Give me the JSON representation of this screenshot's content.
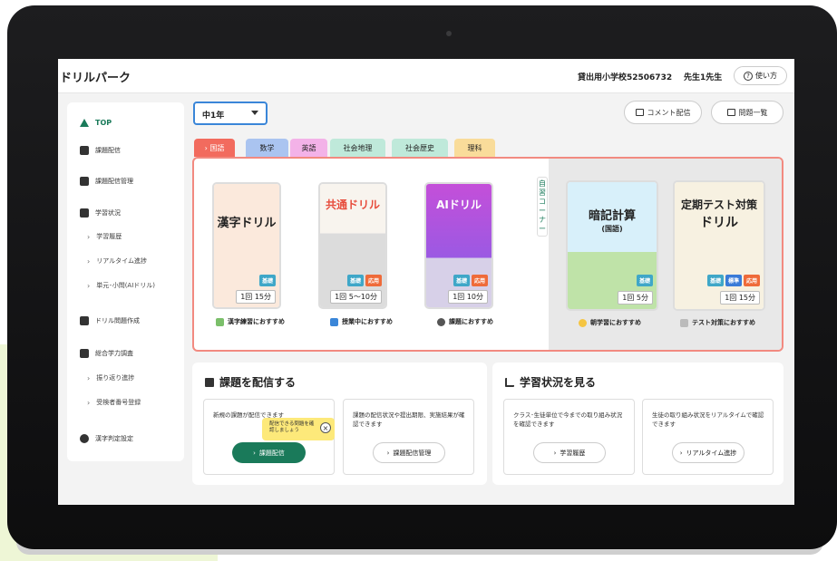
{
  "app": {
    "title": "ドリルパーク",
    "school": "貸出用小学校52506732",
    "teacher": "先生1先生",
    "help_label": "使い方",
    "help_icon": "?"
  },
  "sidebar": {
    "items": [
      {
        "label": "TOP",
        "icon": "home-icon"
      },
      {
        "label": "課題配信",
        "icon": "assignment-icon"
      },
      {
        "label": "課題配信管理",
        "icon": "assignment-manage-icon"
      },
      {
        "label": "学習状況",
        "icon": "chart-icon"
      },
      {
        "label": "学習履歴",
        "icon": "chevron-right-icon"
      },
      {
        "label": "リアルタイム進捗",
        "icon": "chevron-right-icon"
      },
      {
        "label": "単元･小問(AIドリル)",
        "icon": "chevron-right-icon"
      },
      {
        "label": "ドリル問題作成",
        "icon": "pencil-icon"
      },
      {
        "label": "総合学力調査",
        "icon": "people-icon"
      },
      {
        "label": "振り返り進捗",
        "icon": "chevron-right-icon"
      },
      {
        "label": "受検者番号登録",
        "icon": "chevron-right-icon"
      },
      {
        "label": "漢字判定設定",
        "icon": "check-circle-icon"
      }
    ],
    "chevron": "›"
  },
  "grade_select": {
    "value": "中1年"
  },
  "toolbar": {
    "comment_label": "コメント配信",
    "list_label": "問題一覧"
  },
  "tabs": [
    {
      "label": "› 国語",
      "color": "#f26b5e",
      "active": true
    },
    {
      "label": "数学",
      "color": "#aac4f0"
    },
    {
      "label": "英語",
      "color": "#f3b2e8"
    },
    {
      "label": "社会地理",
      "color": "#bfe9da"
    },
    {
      "label": "社会歴史",
      "color": "#bfe9da"
    },
    {
      "label": "理科",
      "color": "#f9dc9a"
    }
  ],
  "jishu_label": "自習コーナー",
  "drills": [
    {
      "title": "漢字ドリル",
      "badges": [
        "基礎"
      ],
      "time": "1回 15分",
      "rec": "漢字練習におすすめ"
    },
    {
      "title": "共通ドリル",
      "badges": [
        "基礎",
        "応用"
      ],
      "time": "1回 5〜10分",
      "rec": "授業中におすすめ"
    },
    {
      "title": "AIドリル",
      "badges": [
        "基礎",
        "応用"
      ],
      "time": "1回 10分",
      "rec": "課題におすすめ"
    },
    {
      "title": "暗記計算",
      "subtitle": "(国語)",
      "badges": [
        "基礎"
      ],
      "time": "1回 5分",
      "rec": "朝学習におすすめ"
    },
    {
      "title": "定期テスト対策",
      "title2": "ドリル",
      "badges": [
        "基礎",
        "標準",
        "応用"
      ],
      "time": "1回 15分",
      "rec": "テスト対策におすすめ"
    }
  ],
  "assign_section": {
    "title": "課題を配信する",
    "box1": {
      "text": "新規の課題が配信できます",
      "button": "課題配信",
      "tooltip": "配信できる問題を確認しましょう",
      "tooltip_close": "×"
    },
    "box2": {
      "text": "課題の配信状況や提出期限、実施結果が確認できます",
      "button": "課題配信管理"
    }
  },
  "status_section": {
    "title": "学習状況を見る",
    "box1": {
      "text": "クラス･生徒単位で今までの取り組み状況を確認できます",
      "button": "学習履歴"
    },
    "box2": {
      "text": "生徒の取り組み状況をリアルタイムで確認できます",
      "button": "リアルタイム進捗"
    }
  },
  "colors": {
    "accent": "#1a7a5a",
    "panel_border": "#f28a80",
    "tooltip": "#fde97a"
  }
}
